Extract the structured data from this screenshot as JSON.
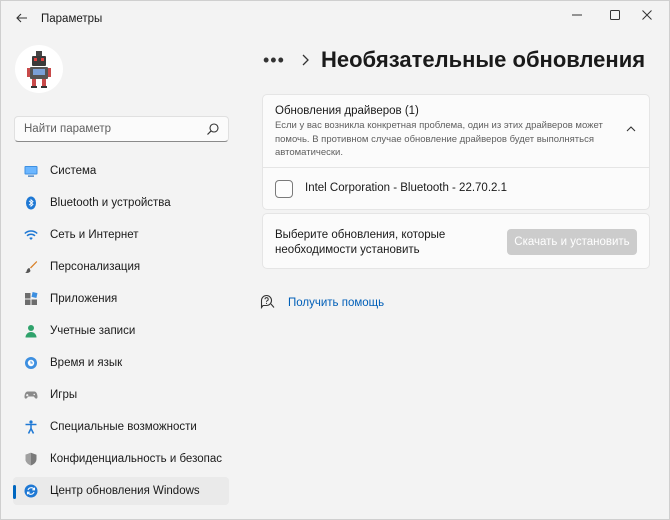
{
  "window": {
    "title": "Параметры"
  },
  "sidebar": {
    "search_placeholder": "Найти параметр",
    "items": [
      {
        "label": "Система",
        "icon": "system-icon"
      },
      {
        "label": "Bluetooth и устройства",
        "icon": "bluetooth-icon"
      },
      {
        "label": "Сеть и Интернет",
        "icon": "wifi-icon"
      },
      {
        "label": "Персонализация",
        "icon": "brush-icon"
      },
      {
        "label": "Приложения",
        "icon": "apps-icon"
      },
      {
        "label": "Учетные записи",
        "icon": "account-icon"
      },
      {
        "label": "Время и язык",
        "icon": "globe-icon"
      },
      {
        "label": "Игры",
        "icon": "gamepad-icon"
      },
      {
        "label": "Специальные возможности",
        "icon": "accessibility-icon"
      },
      {
        "label": "Конфиденциальность и безопас",
        "icon": "shield-icon"
      },
      {
        "label": "Центр обновления Windows",
        "icon": "update-icon",
        "active": true
      }
    ]
  },
  "main": {
    "breadcrumb_more": "•••",
    "page_title": "Необязательные обновления",
    "drivers": {
      "title": "Обновления драйверов (1)",
      "description": "Если у вас возникла конкретная проблема, один из этих драйверов может помочь. В противном случае обновление драйверов будет выполняться автоматически.",
      "items": [
        {
          "name": "Intel Corporation - Bluetooth - 22.70.2.1",
          "checked": false
        }
      ]
    },
    "install": {
      "text": "Выберите обновления, которые необходимости установить",
      "button": "Скачать и установить"
    },
    "help_link": "Получить помощь"
  },
  "colors": {
    "accent": "#0067c0",
    "link": "#005fb8",
    "button_disabled": "#cccccc"
  }
}
